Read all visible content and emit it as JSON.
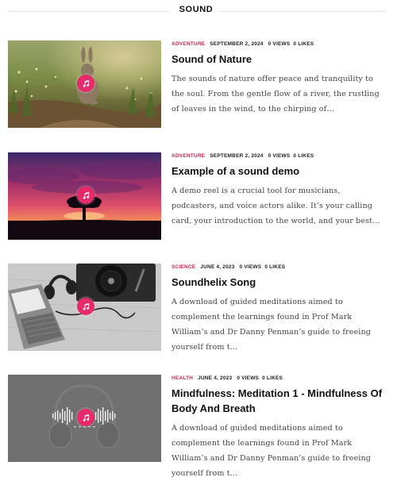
{
  "section": {
    "title": "SOUND"
  },
  "posts": [
    {
      "category": "ADVENTURE",
      "date": "SEPTEMBER 2, 2024",
      "views": "0 VIEWS",
      "likes": "0 LIKES",
      "title": "Sound of Nature",
      "excerpt": "The sounds of nature offer peace and tranquility to the soul. From the gentle flow of a river, the rustling of leaves in the wind, to the chirping of…",
      "thumbnail": "rabbit-in-grass"
    },
    {
      "category": "ADVENTURE",
      "date": "SEPTEMBER 2, 2024",
      "views": "0 VIEWS",
      "likes": "0 LIKES",
      "title": "Example of a sound demo",
      "excerpt": "A demo reel is a crucial tool for musicians, podcasters, and voice actors alike. It’s your calling card, your introduction to the world, and your best…",
      "thumbnail": "tree-at-sunset"
    },
    {
      "category": "SCIENCE",
      "date": "JUNE 4, 2023",
      "views": "0 VIEWS",
      "likes": "0 LIKES",
      "title": "Soundhelix Song",
      "excerpt": "A download of guided meditations aimed to complement the learnings found in Prof Mark William’s and Dr Danny Penman’s guide to freeing yourself from t…",
      "thumbnail": "laptop-headphones-turntable"
    },
    {
      "category": "HEALTH",
      "date": "JUNE 4, 2023",
      "views": "0 VIEWS",
      "likes": "0 LIKES",
      "title": "Mindfulness: Meditation 1 - Mindfulness Of Body And Breath",
      "excerpt": "A download of guided meditations aimed to complement the learnings found in Prof Mark William’s and Dr Danny Penman’s guide to freeing yourself from t…",
      "thumbnail": "headphones-waveform-audio"
    }
  ],
  "colors": {
    "accent": "#e62b6b",
    "category": "#d9214e"
  },
  "icons": {
    "audio_badge": "music-note-icon"
  }
}
